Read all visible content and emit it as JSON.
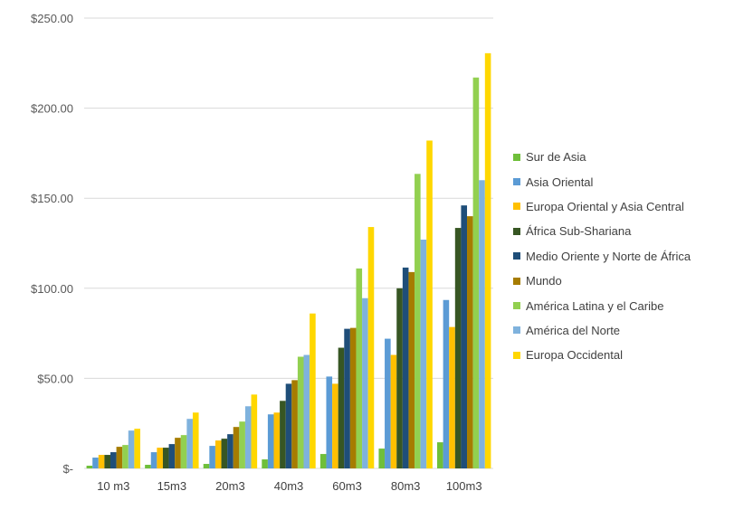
{
  "chart_data": {
    "type": "bar",
    "categories": [
      "10 m3",
      "15m3",
      "20m3",
      "40m3",
      "60m3",
      "80m3",
      "100m3"
    ],
    "y_ticks": [
      "$-",
      "$50.00",
      "$100.00",
      "$150.00",
      "$200.00",
      "$250.00"
    ],
    "ylim": [
      0,
      250
    ],
    "grid": true,
    "legend_position": "right",
    "series": [
      {
        "name": "Sur de Asia",
        "color": "#6fbf3a",
        "values": [
          1.5,
          2,
          2.5,
          5,
          8,
          11,
          14.5
        ]
      },
      {
        "name": "Asia Oriental",
        "color": "#5b9bd5",
        "values": [
          6,
          9,
          12.5,
          30,
          51,
          72,
          93.5
        ]
      },
      {
        "name": "Europa Oriental y Asia Central",
        "color": "#ffc000",
        "values": [
          7.5,
          11.5,
          15.5,
          31,
          47,
          63,
          78.5
        ]
      },
      {
        "name": "África Sub-Shariana",
        "color": "#375623",
        "values": [
          7.5,
          11.5,
          16.5,
          37.5,
          67,
          100,
          133.5
        ]
      },
      {
        "name": "Medio Oriente y Norte de África",
        "color": "#1f4e79",
        "values": [
          9,
          13.5,
          19,
          47,
          77.5,
          111.5,
          146
        ]
      },
      {
        "name": "Mundo",
        "color": "#a67c00",
        "values": [
          12,
          17,
          23,
          49,
          78,
          109,
          140
        ]
      },
      {
        "name": "América Latina y el Caribe",
        "color": "#92d050",
        "values": [
          13,
          18.5,
          26,
          62,
          111,
          163.5,
          217
        ]
      },
      {
        "name": "América del Norte",
        "color": "#7fb2dd",
        "values": [
          21,
          27.5,
          34.5,
          63,
          94.5,
          127,
          160
        ]
      },
      {
        "name": "Europa Occidental",
        "color": "#ffd700",
        "values": [
          22,
          31,
          41,
          86,
          134,
          182,
          230.5
        ]
      }
    ]
  }
}
